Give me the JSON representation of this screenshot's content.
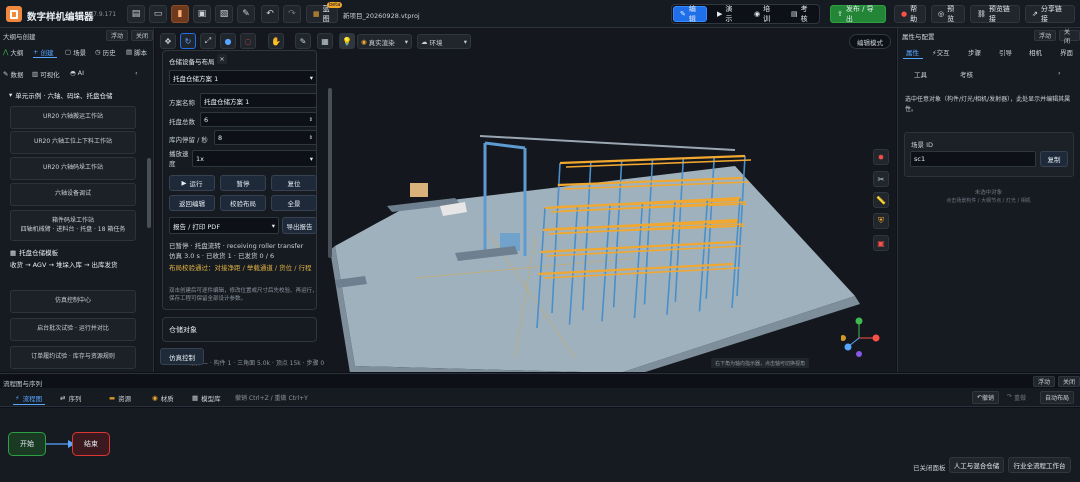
{
  "toolbar": {
    "app_title": "数字样机编辑器",
    "version": "V7.9.171",
    "beta_badge": "beta",
    "blueprint_label": "蓝图",
    "filename": "新项目_20260928.vtproj",
    "modes": [
      "编辑",
      "演示",
      "培训",
      "考核"
    ],
    "publish_label": "发布 / 导出",
    "help_label": "帮助",
    "preview_label": "预览",
    "preview_link_label": "预览链接",
    "share_link_label": "分享链接"
  },
  "left_panel": {
    "title": "大纲与创建",
    "float_label": "浮动",
    "close_label": "关闭",
    "tabs": [
      "大纲",
      "创建",
      "场景",
      "历史",
      "脚本"
    ],
    "tabs2": [
      "数据",
      "可视化",
      "AI"
    ],
    "section_title": "单元示例 · 六轴、码垛、托盘仓储",
    "items": [
      "UR20 六轴搬运工作站",
      "UR20 六轴工位上下料工作站",
      "UR20 六轴码垛工作站",
      "六轴设备调试",
      "箱件码垛工作站",
      "四轴机械臂 · 进料台 · 托盘 · 18 箱任务",
      "托盘仓储模板",
      "收货 → AGV → 堆垛入库 → 出库发货",
      "仿真控制中心",
      "启台批次试验 · 运行并对比",
      "订单履约试验 · 库存与资源规则"
    ]
  },
  "viewport": {
    "render_mode": "真实渲染",
    "environment": "环境",
    "edit_mode": "编辑模式",
    "stats": "场景 — · 构件 1 · 三角面 5.0k · 顶点 15k · 步骤 0",
    "hint": "右下角为轴向指示器，点击轴可切换视角",
    "sim_button": "仿真控制"
  },
  "dialog": {
    "title": "仓储设备与布局",
    "close": "×",
    "scheme_select": "托盘仓储方案 1",
    "scheme_name_label": "方案名称",
    "scheme_name": "托盘仓储方案 1",
    "pallet_total_label": "托盘总数",
    "pallet_total": "6",
    "dwell_label": "库内停留 / 秒",
    "dwell": "8",
    "speed_label": "播放速度",
    "speed": "1x",
    "buttons": [
      "运行",
      "暂停",
      "复位",
      "返回编辑",
      "校验布局",
      "全景"
    ],
    "report_select": "报告 / 打印 PDF",
    "export_label": "导出报告",
    "status1": "已暂停 · 托盘流转 · receiving roller transfer",
    "status2": "仿真 3.0 s · 已收货 1 · 已发货 0 / 6",
    "layout_check": "布局校验通过：对接净距 / 举载通道 / 货位 / 行程",
    "note": "双击创建后可逐件编辑，修改位置或尺寸后先校验、再运行，保存工程可保留全部设计参数。",
    "section2": "仓储对象"
  },
  "right_panel": {
    "title": "属性与配置",
    "float_label": "浮动",
    "close_label": "关闭",
    "tabs": [
      "属性",
      "交互",
      "步骤",
      "引导",
      "相机",
      "界面"
    ],
    "tabs2": [
      "工具",
      "考核"
    ],
    "hint": "选中任意对象（构件/灯光/相机/发射器），此处显示并编辑其属性。",
    "scene_id_label": "场景 ID",
    "scene_id": "sc1",
    "copy_label": "复制",
    "unselected": "未选中对象",
    "unselected_hint": "点击场景构件 / 大纲节点 / 灯光 / 相机"
  },
  "bottom_panel": {
    "title": "流程图与序列",
    "float_label": "浮动",
    "close_label": "关闭",
    "tabs": [
      "流程图",
      "序列",
      "资源",
      "材质",
      "模型库"
    ],
    "undo_hint": "撤销 Ctrl+Z / 重做 Ctrl+Y",
    "undo_label": "撤销",
    "redo_label": "重做",
    "autolayout_label": "自动布局",
    "node_start": "开始",
    "node_end": "结束",
    "closed_panels_label": "已关闭面板",
    "closed_panel_a": "人工与混合仓储",
    "closed_panel_b": "行业全流程工作台"
  },
  "colors": {
    "accent": "#1f6feb",
    "publish": "#238636",
    "rack_upright": "#4a8fc9",
    "rack_beam": "#f0a830",
    "floor": "#a7b9c6",
    "node_start": "#2ea043",
    "node_end": "#da3633"
  }
}
